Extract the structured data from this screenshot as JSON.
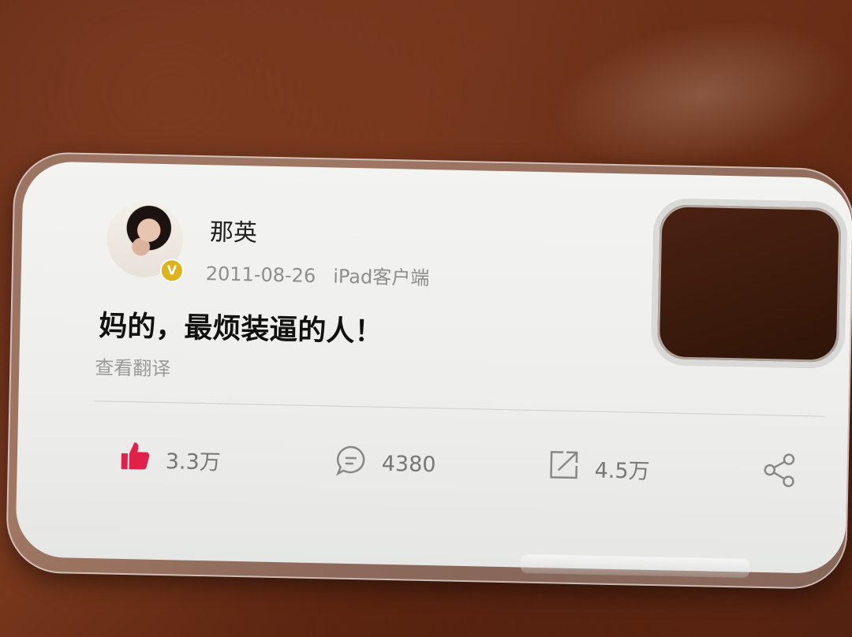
{
  "post": {
    "username": "那英",
    "date": "2011-08-26",
    "source": "iPad客户端",
    "verified_mark": "V",
    "text": "妈的，最烦装逼的人！",
    "translate": "查看翻译"
  },
  "actions": {
    "likes": "3.3万",
    "comments": "4380",
    "reposts": "4.5万"
  },
  "icons": {
    "like": "thumbs-up-icon",
    "comment": "comment-bubble-icon",
    "repost": "repost-icon",
    "share": "share-icon"
  },
  "colors": {
    "like": "#e0224a",
    "verified": "#e0b21a"
  }
}
